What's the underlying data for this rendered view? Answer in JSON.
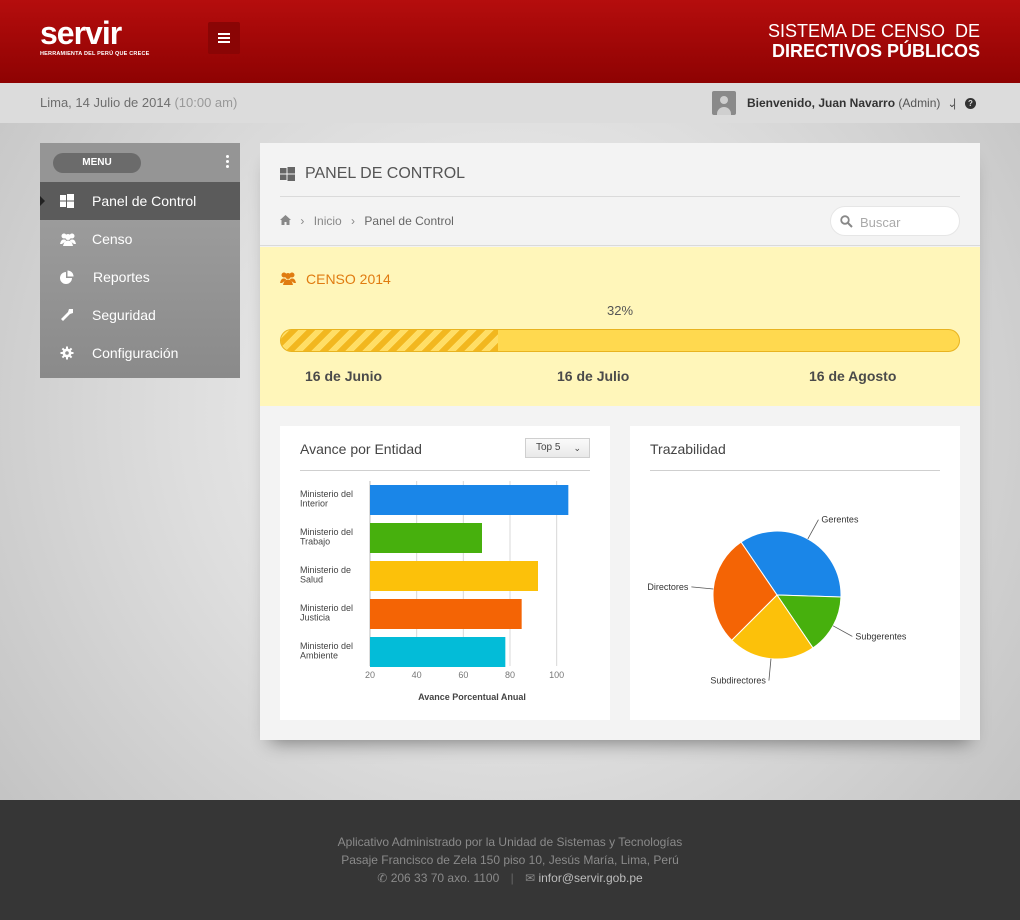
{
  "header": {
    "logo_word": "servir",
    "logo_tagline": "HERRAMIENTA DEL PERÚ QUE CRECE",
    "title_line1": "SISTEMA DE CENSO  DE",
    "title_line2": "DIRECTIVOS PÚBLICOS",
    "menu_icon": "hamburger-icon"
  },
  "subbar": {
    "date": "Lima, 14 Julio de 2014",
    "time": "(10:00 am)",
    "welcome": "Bienvenido, Juan Navarro",
    "role": "(Admin)",
    "separator": "|"
  },
  "sidebar": {
    "menu_label": "MENU",
    "items": [
      {
        "label": "Panel de Control",
        "icon": "windows-icon"
      },
      {
        "label": "Censo",
        "icon": "users-icon"
      },
      {
        "label": "Reportes",
        "icon": "pie-chart-icon"
      },
      {
        "label": "Seguridad",
        "icon": "wrench-icon"
      },
      {
        "label": "Configuración",
        "icon": "gear-icon"
      }
    ]
  },
  "panel": {
    "title": "PANEL DE CONTROL",
    "breadcrumb": {
      "home": "Inicio",
      "current": "Panel de Control"
    },
    "search_placeholder": "Buscar"
  },
  "census": {
    "title": "CENSO 2014",
    "progress_percent": 32,
    "progress_label": "32%",
    "milestones": [
      "16 de Junio",
      "16 de Julio",
      "16 de Agosto"
    ]
  },
  "colors": {
    "header_red": "#a30707",
    "accent_orange": "#e07b10",
    "census_bg": "#fff6ba"
  },
  "chart_data": [
    {
      "type": "bar",
      "orientation": "horizontal",
      "title": "Avance por Entidad",
      "filter": "Top 5",
      "categories": [
        "Ministerio del Interior",
        "Ministerio del Trabajo",
        "Ministerio de Salud",
        "Ministerio del Justicia",
        "Ministerio del Ambiente"
      ],
      "category_lines": [
        [
          "Ministerio del",
          "Interior"
        ],
        [
          "Ministerio del",
          "Trabajo"
        ],
        [
          "Ministerio de",
          "Salud"
        ],
        [
          "Ministerio del",
          "Justicia"
        ],
        [
          "Ministerio del",
          "Ambiente"
        ]
      ],
      "values": [
        105,
        68,
        92,
        85,
        78
      ],
      "colors": [
        "#1a86e8",
        "#47b00d",
        "#fcc10a",
        "#f46405",
        "#03bcd8"
      ],
      "xlabel": "Avance Porcentual Anual",
      "xticks": [
        20,
        40,
        60,
        80,
        100
      ],
      "xlim": [
        20,
        110
      ],
      "grid": true
    },
    {
      "type": "pie",
      "title": "Trazabilidad",
      "labels": [
        "Gerentes",
        "Subgerentes",
        "Subdirectores",
        "Directores"
      ],
      "values": [
        35,
        15,
        22,
        28
      ],
      "colors": [
        "#1a86e8",
        "#47b00d",
        "#fcc10a",
        "#f46405"
      ]
    }
  ],
  "footer": {
    "line1": "Aplicativo Administrado por la Unidad de Sistemas y Tecnologías",
    "line2": "Pasaje Francisco de Zela 150 piso 10, Jesús María, Lima, Perú",
    "phone": "206 33 70 axo. 1100",
    "email": "infor@servir.gob.pe"
  }
}
